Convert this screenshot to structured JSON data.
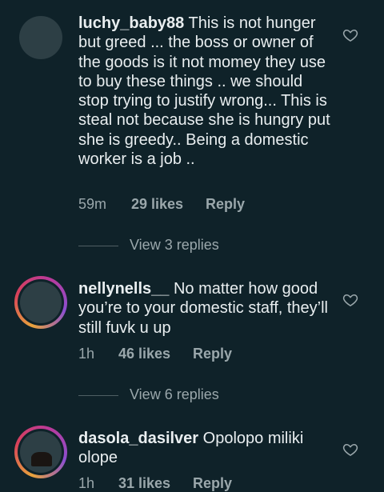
{
  "comments": [
    {
      "username": "luchy_baby88",
      "text": "This is not hunger but greed ... the boss or owner of the goods is it not momey they use to buy these things .. we should stop trying to justify wrong... This is steal not because she is hungry put she is greedy.. Being a domestic worker is a job ..",
      "time": "59m",
      "likes": "29 likes",
      "reply": "Reply",
      "view_replies": "View 3 replies"
    },
    {
      "username": "nellynells__",
      "text": "No matter how good you’re to your domestic staff, they’ll still fuvk u up",
      "time": "1h",
      "likes": "46 likes",
      "reply": "Reply",
      "view_replies": "View 6 replies"
    },
    {
      "username": "dasola_dasilver",
      "text": "Opolopo miliki olope",
      "time": "1h",
      "likes": "31 likes",
      "reply": "Reply"
    }
  ],
  "icons": {
    "like": "heart-outline-icon"
  },
  "colors": {
    "background": "#0f2229",
    "text": "#e9eef0",
    "muted": "#9aa7ab"
  }
}
